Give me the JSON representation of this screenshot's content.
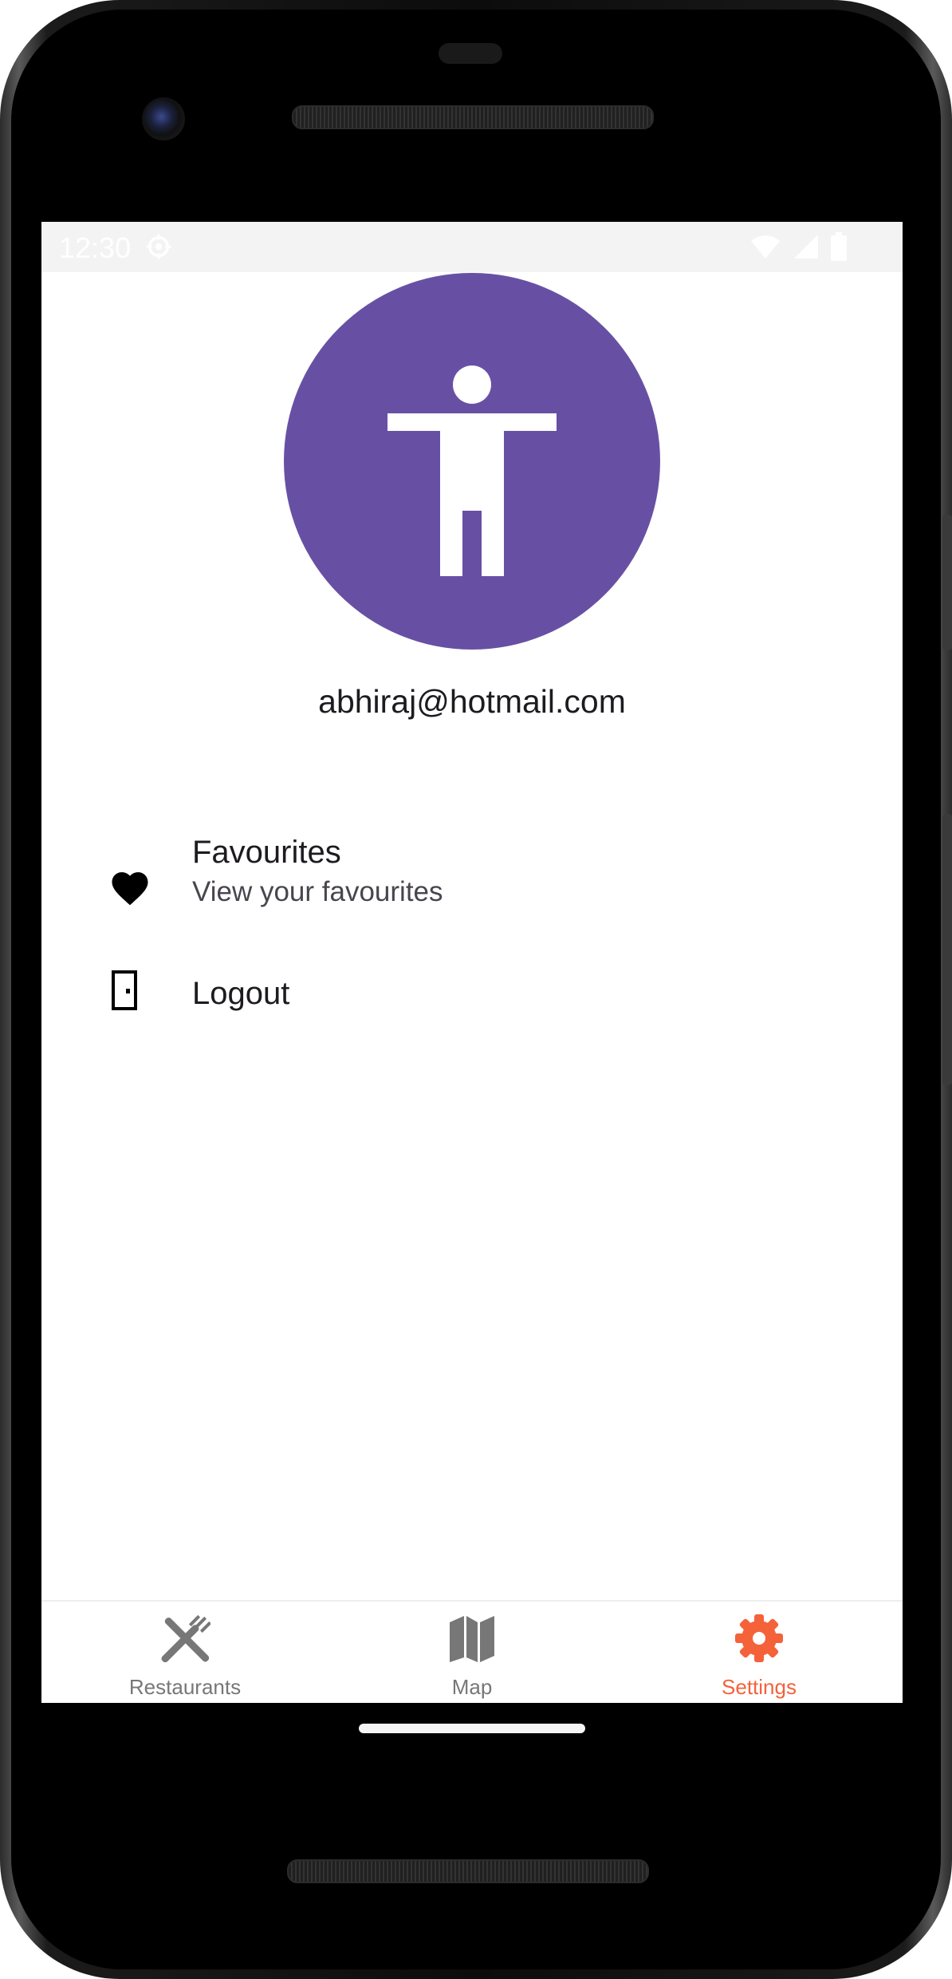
{
  "status_bar": {
    "time": "12:30"
  },
  "profile": {
    "email": "abhiraj@hotmail.com",
    "avatar_color": "#6750A4",
    "avatar_icon": "accessibility-icon"
  },
  "menu": {
    "items": [
      {
        "title": "Favourites",
        "subtitle": "View your favourites",
        "icon": "heart-icon"
      },
      {
        "title": "Logout",
        "icon": "door-icon"
      }
    ]
  },
  "bottom_nav": {
    "items": [
      {
        "label": "Restaurants",
        "icon": "restaurant-icon",
        "active": false
      },
      {
        "label": "Map",
        "icon": "map-icon",
        "active": false
      },
      {
        "label": "Settings",
        "icon": "settings-icon",
        "active": true
      }
    ],
    "active_color": "#F4623A",
    "inactive_color": "#777777"
  }
}
